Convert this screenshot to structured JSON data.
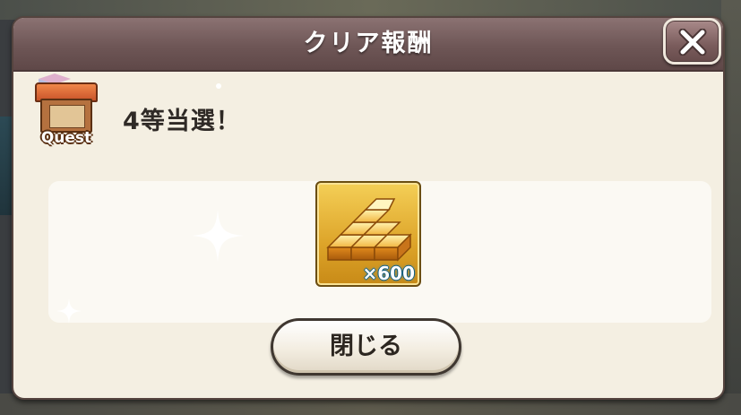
{
  "dialog": {
    "title": "クリア報酬",
    "close_icon": "close-x-icon",
    "quest_icon": "quest-shop-icon",
    "quest_label": "Quest",
    "result_text": "4等当選！",
    "reward": {
      "icon": "gold-bars-icon",
      "quantity": "×600"
    },
    "close_button_label": "閉じる"
  }
}
